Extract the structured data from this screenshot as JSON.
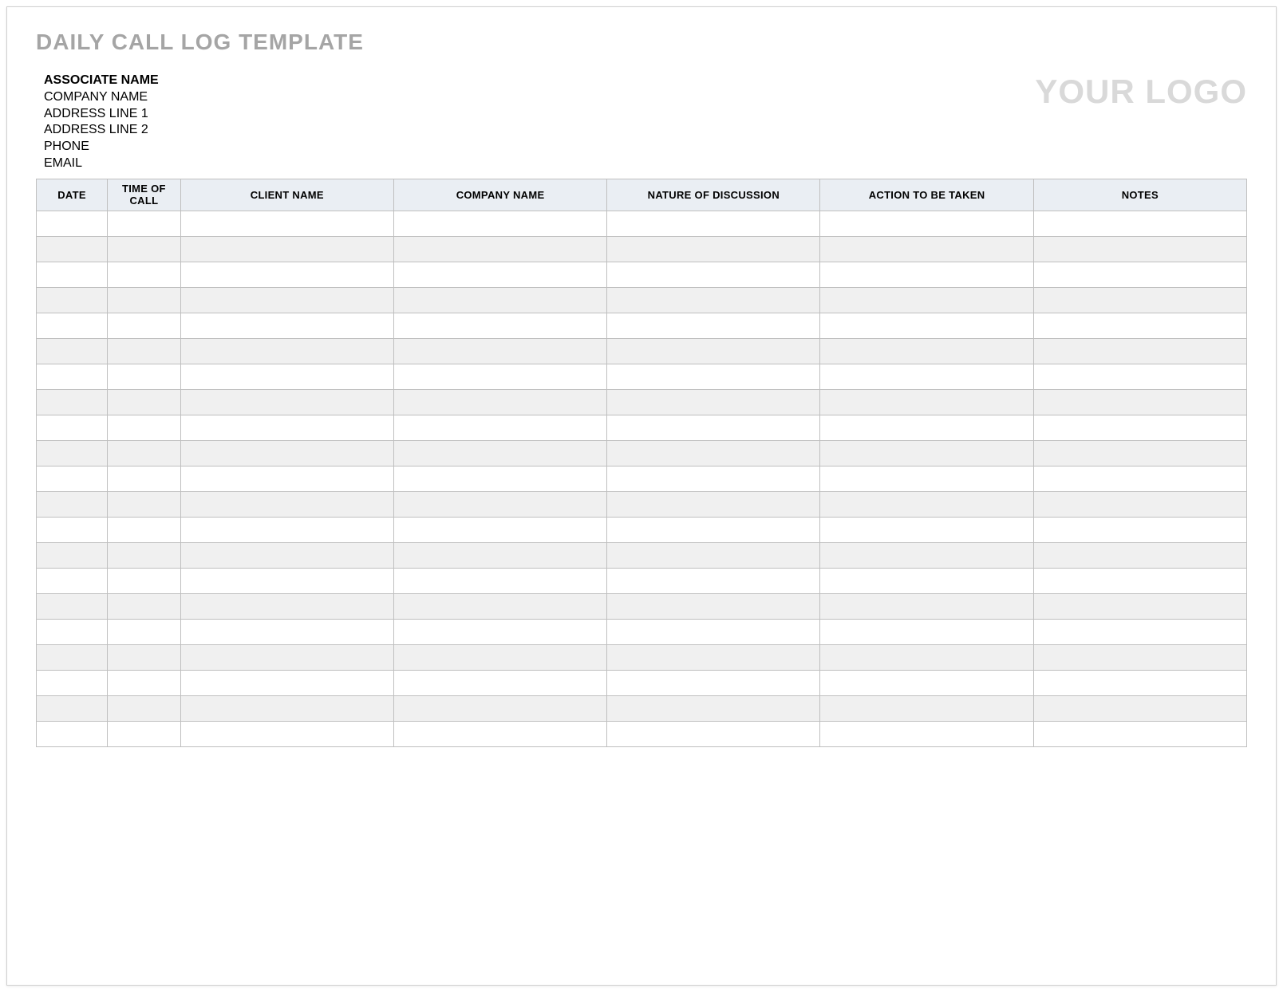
{
  "title": "DAILY CALL LOG TEMPLATE",
  "logo_text": "YOUR LOGO",
  "associate": {
    "name": "ASSOCIATE NAME",
    "company": "COMPANY NAME",
    "address1": "ADDRESS LINE 1",
    "address2": "ADDRESS LINE 2",
    "phone": "PHONE",
    "email": "EMAIL"
  },
  "table": {
    "headers": {
      "date": "DATE",
      "time_of_call": "TIME OF CALL",
      "client_name": "CLIENT NAME",
      "company_name": "COMPANY NAME",
      "nature_of_discussion": "NATURE OF DISCUSSION",
      "action_to_be_taken": "ACTION TO BE TAKEN",
      "notes": "NOTES"
    },
    "rows": [
      {
        "date": "",
        "time": "",
        "client": "",
        "company": "",
        "nature": "",
        "action": "",
        "notes": ""
      },
      {
        "date": "",
        "time": "",
        "client": "",
        "company": "",
        "nature": "",
        "action": "",
        "notes": ""
      },
      {
        "date": "",
        "time": "",
        "client": "",
        "company": "",
        "nature": "",
        "action": "",
        "notes": ""
      },
      {
        "date": "",
        "time": "",
        "client": "",
        "company": "",
        "nature": "",
        "action": "",
        "notes": ""
      },
      {
        "date": "",
        "time": "",
        "client": "",
        "company": "",
        "nature": "",
        "action": "",
        "notes": ""
      },
      {
        "date": "",
        "time": "",
        "client": "",
        "company": "",
        "nature": "",
        "action": "",
        "notes": ""
      },
      {
        "date": "",
        "time": "",
        "client": "",
        "company": "",
        "nature": "",
        "action": "",
        "notes": ""
      },
      {
        "date": "",
        "time": "",
        "client": "",
        "company": "",
        "nature": "",
        "action": "",
        "notes": ""
      },
      {
        "date": "",
        "time": "",
        "client": "",
        "company": "",
        "nature": "",
        "action": "",
        "notes": ""
      },
      {
        "date": "",
        "time": "",
        "client": "",
        "company": "",
        "nature": "",
        "action": "",
        "notes": ""
      },
      {
        "date": "",
        "time": "",
        "client": "",
        "company": "",
        "nature": "",
        "action": "",
        "notes": ""
      },
      {
        "date": "",
        "time": "",
        "client": "",
        "company": "",
        "nature": "",
        "action": "",
        "notes": ""
      },
      {
        "date": "",
        "time": "",
        "client": "",
        "company": "",
        "nature": "",
        "action": "",
        "notes": ""
      },
      {
        "date": "",
        "time": "",
        "client": "",
        "company": "",
        "nature": "",
        "action": "",
        "notes": ""
      },
      {
        "date": "",
        "time": "",
        "client": "",
        "company": "",
        "nature": "",
        "action": "",
        "notes": ""
      },
      {
        "date": "",
        "time": "",
        "client": "",
        "company": "",
        "nature": "",
        "action": "",
        "notes": ""
      },
      {
        "date": "",
        "time": "",
        "client": "",
        "company": "",
        "nature": "",
        "action": "",
        "notes": ""
      },
      {
        "date": "",
        "time": "",
        "client": "",
        "company": "",
        "nature": "",
        "action": "",
        "notes": ""
      },
      {
        "date": "",
        "time": "",
        "client": "",
        "company": "",
        "nature": "",
        "action": "",
        "notes": ""
      },
      {
        "date": "",
        "time": "",
        "client": "",
        "company": "",
        "nature": "",
        "action": "",
        "notes": ""
      },
      {
        "date": "",
        "time": "",
        "client": "",
        "company": "",
        "nature": "",
        "action": "",
        "notes": ""
      }
    ]
  }
}
